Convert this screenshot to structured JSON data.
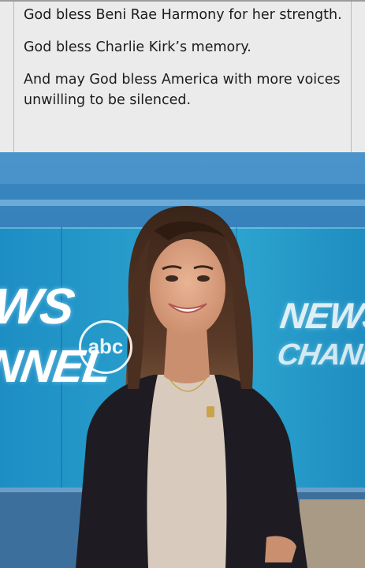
{
  "post": {
    "paragraphs": [
      "God bless Beni Rae Harmony for her strength.",
      "God bless Charlie Kirk’s memory.",
      "And may God bless America with more voices unwilling to be silenced."
    ]
  },
  "photo": {
    "backdrop_left_top": "WS",
    "backdrop_left_bottom": "NNEL",
    "backdrop_logo": "abc",
    "backdrop_right_top": "NEWS",
    "backdrop_right_bottom": "CHANNEL"
  },
  "colors": {
    "panel_background": "#ebebeb",
    "panel_text": "#1c1c1c",
    "studio_blue": "#2b72a8"
  }
}
